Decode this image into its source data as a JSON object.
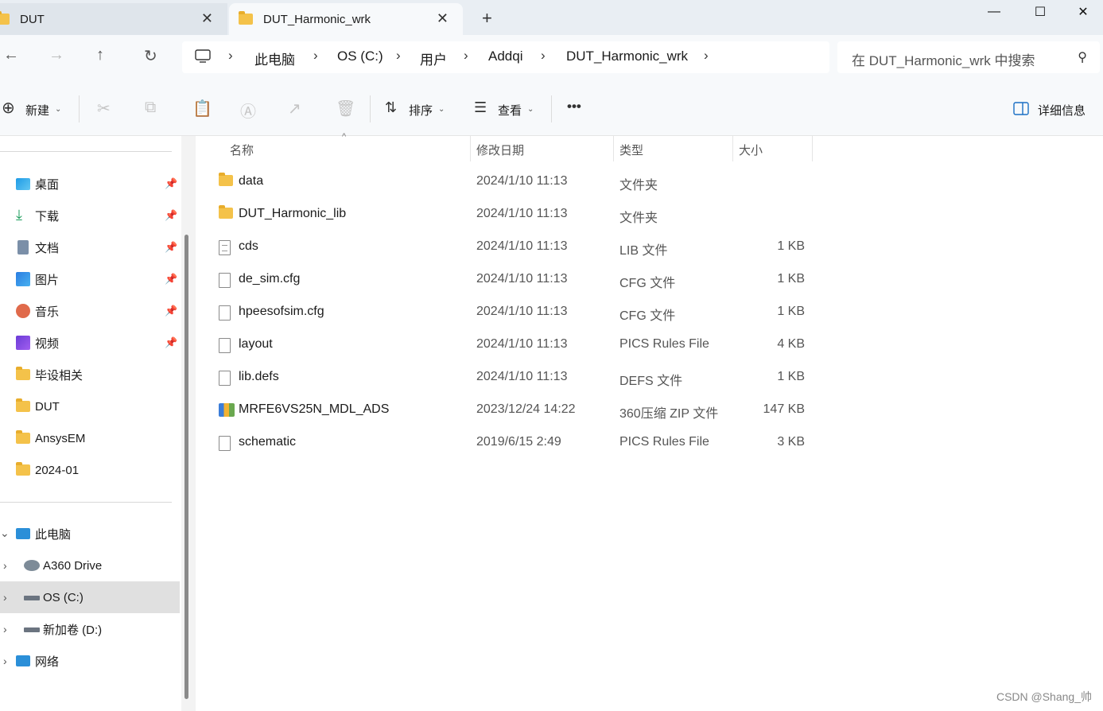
{
  "tabs": [
    {
      "label": "DUT",
      "active": false
    },
    {
      "label": "DUT_Harmonic_wrk",
      "active": true
    }
  ],
  "window_controls": {
    "minimize": "—",
    "maximize": "☐",
    "close": "✕"
  },
  "breadcrumb": [
    "此电脑",
    "OS (C:)",
    "用户",
    "Addqi",
    "DUT_Harmonic_wrk"
  ],
  "search": {
    "placeholder": "在 DUT_Harmonic_wrk 中搜索"
  },
  "toolbar": {
    "new_label": "新建",
    "sort_label": "排序",
    "view_label": "查看",
    "more_label": "•••",
    "details_label": "详细信息"
  },
  "sidebar": {
    "quick_access": [
      {
        "label": "桌面",
        "icon": "desktop-icon",
        "pinned": true
      },
      {
        "label": "下载",
        "icon": "download-icon",
        "pinned": true
      },
      {
        "label": "文档",
        "icon": "document-icon",
        "pinned": true
      },
      {
        "label": "图片",
        "icon": "pictures-icon",
        "pinned": true
      },
      {
        "label": "音乐",
        "icon": "music-icon",
        "pinned": true
      },
      {
        "label": "视频",
        "icon": "videos-icon",
        "pinned": true
      },
      {
        "label": "毕设相关",
        "icon": "folder-icon",
        "pinned": false
      },
      {
        "label": "DUT",
        "icon": "folder-icon",
        "pinned": false
      },
      {
        "label": "AnsysEM",
        "icon": "folder-icon",
        "pinned": false
      },
      {
        "label": "2024-01",
        "icon": "folder-icon",
        "pinned": false
      }
    ],
    "tree": [
      {
        "label": "此电脑",
        "icon": "computer-icon"
      },
      {
        "label": "A360 Drive",
        "icon": "cloud-drive-icon"
      },
      {
        "label": "OS (C:)",
        "icon": "drive-icon",
        "selected": true
      },
      {
        "label": "新加卷 (D:)",
        "icon": "drive-icon"
      },
      {
        "label": "网络",
        "icon": "network-icon"
      }
    ]
  },
  "columns": {
    "name": "名称",
    "date": "修改日期",
    "type": "类型",
    "size": "大小"
  },
  "files": [
    {
      "name": "data",
      "date": "2024/1/10 11:13",
      "type": "文件夹",
      "size": "",
      "icon": "folder"
    },
    {
      "name": "DUT_Harmonic_lib",
      "date": "2024/1/10 11:13",
      "type": "文件夹",
      "size": "",
      "icon": "folder"
    },
    {
      "name": "cds",
      "date": "2024/1/10 11:13",
      "type": "LIB 文件",
      "size": "1 KB",
      "icon": "text"
    },
    {
      "name": "de_sim.cfg",
      "date": "2024/1/10 11:13",
      "type": "CFG 文件",
      "size": "1 KB",
      "icon": "file"
    },
    {
      "name": "hpeesofsim.cfg",
      "date": "2024/1/10 11:13",
      "type": "CFG 文件",
      "size": "1 KB",
      "icon": "file"
    },
    {
      "name": "layout",
      "date": "2024/1/10 11:13",
      "type": "PICS Rules File",
      "size": "4 KB",
      "icon": "file"
    },
    {
      "name": "lib.defs",
      "date": "2024/1/10 11:13",
      "type": "DEFS 文件",
      "size": "1 KB",
      "icon": "file"
    },
    {
      "name": "MRFE6VS25N_MDL_ADS",
      "date": "2023/12/24 14:22",
      "type": "360压缩 ZIP 文件",
      "size": "147 KB",
      "icon": "zip"
    },
    {
      "name": "schematic",
      "date": "2019/6/15 2:49",
      "type": "PICS Rules File",
      "size": "3 KB",
      "icon": "file"
    }
  ],
  "watermark": "CSDN @Shang_帅"
}
